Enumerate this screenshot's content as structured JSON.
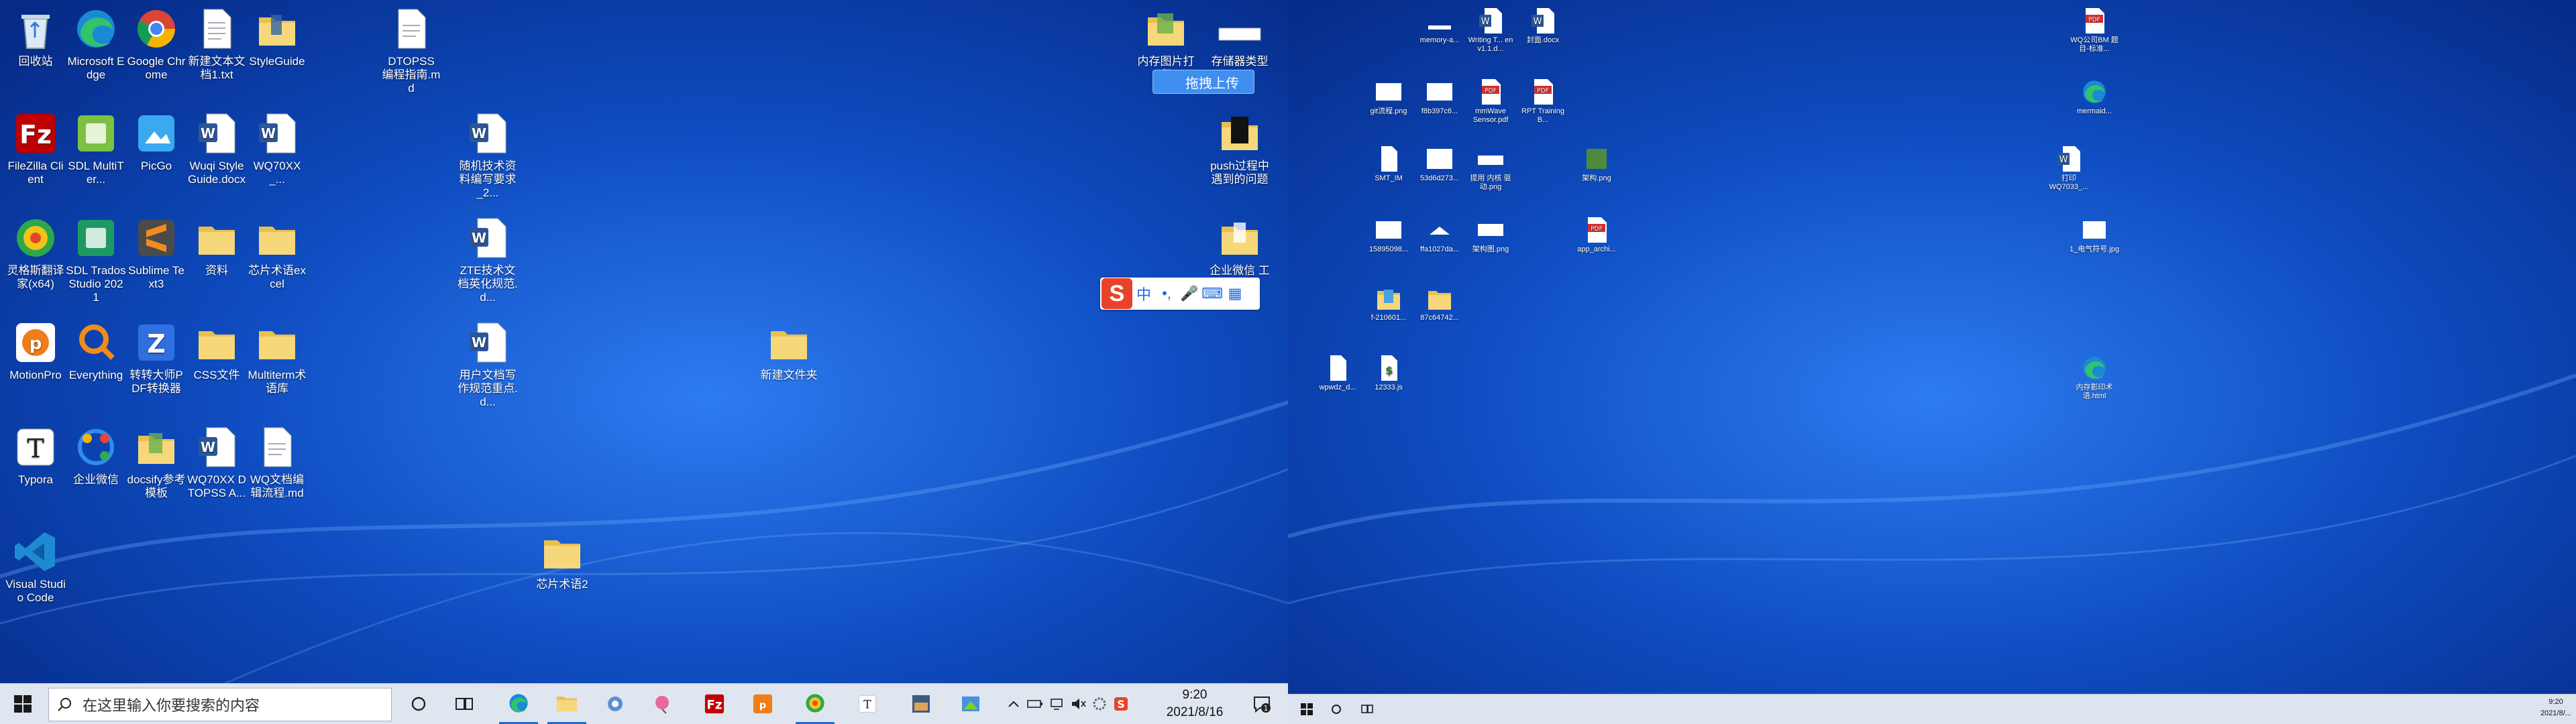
{
  "left_desktop": {
    "icons": [
      {
        "label": "回收站",
        "icon": "recycle-bin-icon"
      },
      {
        "label": "Microsoft Edge",
        "icon": "edge-icon"
      },
      {
        "label": "Google Chrome",
        "icon": "chrome-icon"
      },
      {
        "label": "新建文本文档1.txt",
        "icon": "text-file-icon"
      },
      {
        "label": "StyleGuide",
        "icon": "folder-icon"
      },
      {
        "label": "DTOPSS 编程指南.md",
        "icon": "markdown-file-icon"
      },
      {
        "label": "FileZilla Client",
        "icon": "filezilla-icon"
      },
      {
        "label": "SDL MultiTer...",
        "icon": "sdl-multiterm-icon"
      },
      {
        "label": "PicGo",
        "icon": "picgo-icon"
      },
      {
        "label": "Wuqi Style Guide.docx",
        "icon": "word-doc-icon"
      },
      {
        "label": "WQ70XX_...",
        "icon": "word-doc-icon"
      },
      {
        "label": "随机技术资料编写要求_2...",
        "icon": "word-doc-icon"
      },
      {
        "label": "灵格斯翻译家(x64)",
        "icon": "lingoes-icon"
      },
      {
        "label": "SDL Trados Studio 2021",
        "icon": "sdl-trados-icon"
      },
      {
        "label": "Sublime Text3",
        "icon": "sublime-icon"
      },
      {
        "label": "资料",
        "icon": "folder-icon"
      },
      {
        "label": "芯片术语excel",
        "icon": "folder-icon"
      },
      {
        "label": "ZTE技术文档英化规范.d...",
        "icon": "word-doc-icon"
      },
      {
        "label": "MotionPro",
        "icon": "motionpro-icon"
      },
      {
        "label": "Everything",
        "icon": "everything-icon"
      },
      {
        "label": "转转大师PDF转换器",
        "icon": "pdf-converter-icon"
      },
      {
        "label": "CSS文件",
        "icon": "folder-icon"
      },
      {
        "label": "Multiterm术语库",
        "icon": "folder-icon"
      },
      {
        "label": "用户文档写作规范重点.d...",
        "icon": "word-doc-icon"
      },
      {
        "label": "新建文件夹",
        "icon": "folder-icon"
      },
      {
        "label": "Typora",
        "icon": "typora-icon"
      },
      {
        "label": "企业微信",
        "icon": "wecom-icon"
      },
      {
        "label": "docsify参考模板",
        "icon": "folder-icon"
      },
      {
        "label": "WQ70XX DTOPSS A...",
        "icon": "word-doc-icon"
      },
      {
        "label": "WQ文档编辑流程.md",
        "icon": "markdown-file-icon"
      },
      {
        "label": "Visual Studio Code",
        "icon": "vscode-icon"
      },
      {
        "label": "芯片术语2",
        "icon": "folder-icon"
      },
      {
        "label": "内存图片打印",
        "icon": "folder-icon"
      },
      {
        "label": "存储器类型",
        "icon": "image-file-icon"
      },
      {
        "label": "push过程中遇到的问题",
        "icon": "folder-icon"
      },
      {
        "label": "企业微信 工",
        "icon": "folder-icon"
      }
    ],
    "upload_button": "拖拽上传",
    "ime_toolbar": {
      "logo": "S",
      "mode": "中",
      "punct": "•,",
      "mic": "🎤",
      "keyboard": "⌨",
      "grid": "▦"
    }
  },
  "taskbar": {
    "search_placeholder": "在这里输入你要搜索的内容",
    "time": "9:20",
    "date": "2021/8/16",
    "notification_count": "1"
  },
  "right_desktop": {
    "icons": [
      {
        "label": "memory-a...",
        "icon": "image-file-icon"
      },
      {
        "label": "Writing T... en v1.1.d...",
        "icon": "word-doc-icon"
      },
      {
        "label": "封面.docx",
        "icon": "word-doc-icon"
      },
      {
        "label": "WQ公司BM 题目-标准...",
        "icon": "pdf-icon"
      },
      {
        "label": "git流程.png",
        "icon": "image-file-icon"
      },
      {
        "label": "f8b397c6...",
        "icon": "image-file-icon"
      },
      {
        "label": "mmWave Sensor.pdf",
        "icon": "pdf-icon"
      },
      {
        "label": "RPT Training B...",
        "icon": "pdf-icon"
      },
      {
        "label": "mermaid...",
        "icon": "edge-icon"
      },
      {
        "label": "SMT_IM",
        "icon": "text-file-icon"
      },
      {
        "label": "53d6d273...",
        "icon": "image-file-icon"
      },
      {
        "label": "提用 内核 驱动.png",
        "icon": "image-file-icon"
      },
      {
        "label": "架构.png",
        "icon": "image-file-icon"
      },
      {
        "label": "打印 WQ7033_...",
        "icon": "word-doc-icon"
      },
      {
        "label": "15895098...",
        "icon": "image-file-icon"
      },
      {
        "label": "ffa1027da...",
        "icon": "image-file-icon"
      },
      {
        "label": "架构图.png",
        "icon": "image-file-icon"
      },
      {
        "label": "app_archi...",
        "icon": "pdf-icon"
      },
      {
        "label": "1_电气符号.jpg",
        "icon": "image-file-icon"
      },
      {
        "label": "f-210601...",
        "icon": "folder-icon"
      },
      {
        "label": "87c64742...",
        "icon": "folder-icon"
      },
      {
        "label": "内存影印术语.html",
        "icon": "edge-icon"
      },
      {
        "label": "wpwdz_d...",
        "icon": "text-file-icon"
      },
      {
        "label": "12333.js",
        "icon": "js-file-icon"
      }
    ],
    "taskbar": {
      "time": "9:20",
      "date": "2021/8/..."
    }
  }
}
